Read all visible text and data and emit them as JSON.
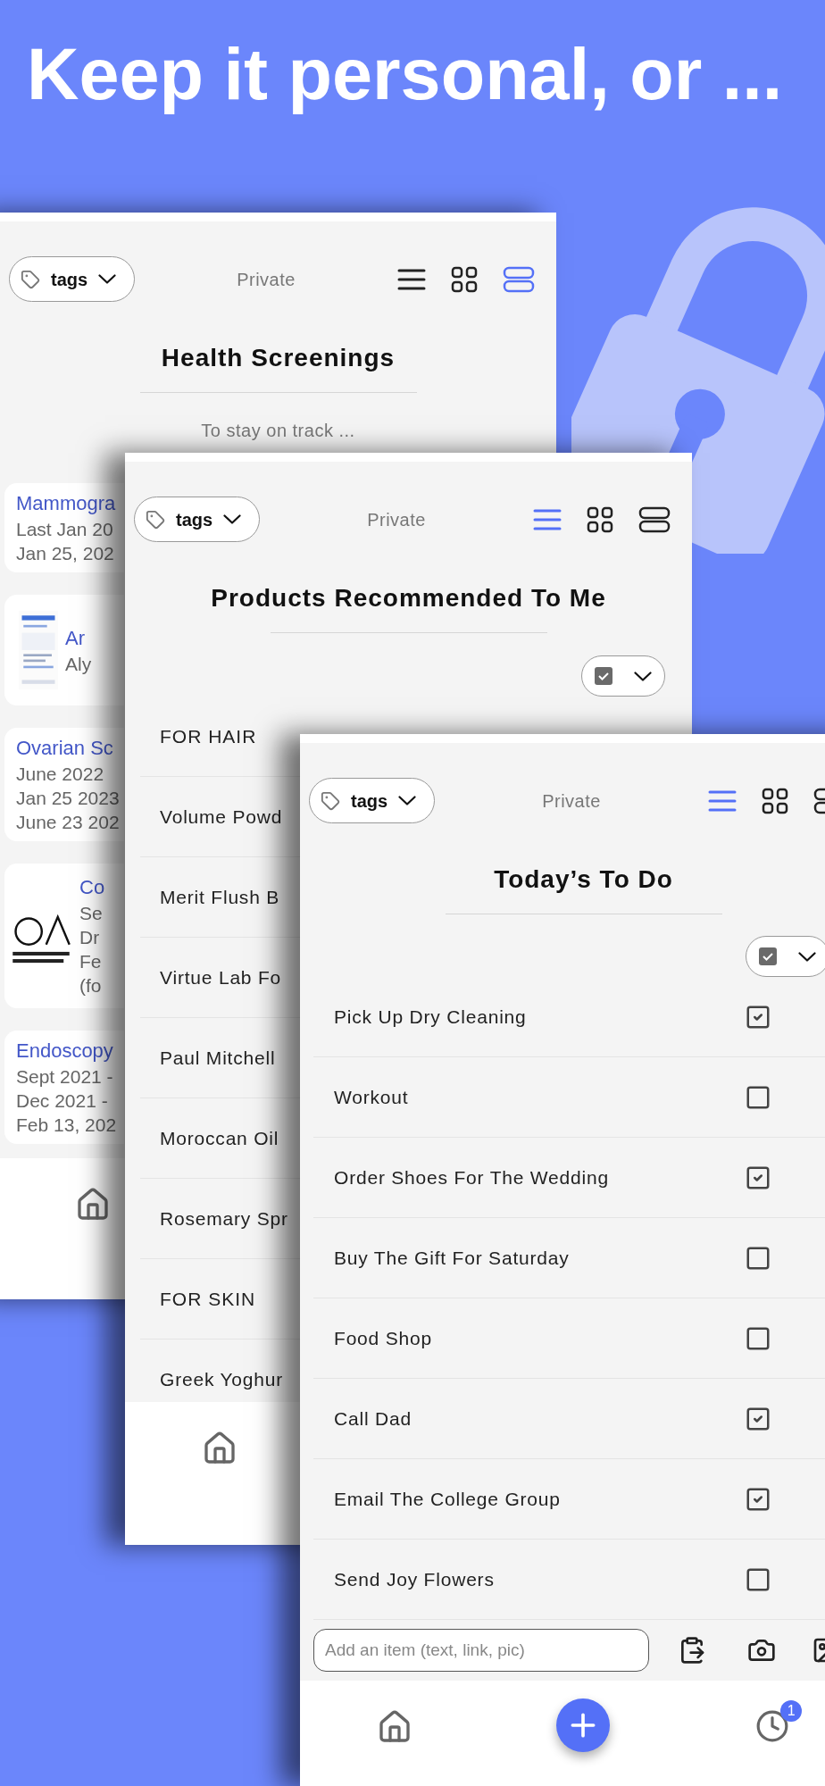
{
  "headline": "Keep it personal, or ...",
  "lists": [
    {
      "kind": "cards",
      "tags_label": "tags",
      "privacy": "Private",
      "view_modes": [
        {
          "kind": "list",
          "selected": false
        },
        {
          "kind": "grid",
          "selected": false
        },
        {
          "kind": "stack",
          "selected": true
        }
      ],
      "title": "Health Screenings",
      "subtitle": "To stay on track ...",
      "entries": [
        {
          "kind": "text",
          "title": "Mammogra",
          "lines": [
            "Last Jan 20",
            "Jan 25, 202"
          ]
        },
        {
          "kind": "thumbnail",
          "title": "Ar",
          "lines": [
            "Aly"
          ]
        },
        {
          "kind": "text",
          "title": "Ovarian Sc",
          "lines": [
            "June 2022",
            "Jan 25 2023",
            "June 23 202"
          ]
        },
        {
          "kind": "thumbnail",
          "title": "Co",
          "lines": [
            "Se",
            "Dr",
            "Fe",
            "(fo"
          ]
        },
        {
          "kind": "text",
          "title": "Endoscopy",
          "lines": [
            "Sept 2021 -",
            "Dec 2021 -",
            "Feb 13, 202"
          ]
        }
      ]
    },
    {
      "kind": "sections",
      "tags_label": "tags",
      "privacy": "Private",
      "view_modes": [
        {
          "kind": "list",
          "selected": true
        },
        {
          "kind": "grid",
          "selected": false
        },
        {
          "kind": "stack",
          "selected": false
        }
      ],
      "title": "Products Recommended To Me",
      "rows": [
        {
          "kind": "heading",
          "text": "FOR HAIR"
        },
        {
          "kind": "item",
          "text": "Volume Powd"
        },
        {
          "kind": "item",
          "text": "Merit Flush B"
        },
        {
          "kind": "item",
          "text": "Virtue Lab Fo"
        },
        {
          "kind": "item",
          "text": "Paul Mitchell"
        },
        {
          "kind": "item",
          "text": "Moroccan Oil"
        },
        {
          "kind": "item",
          "text": "Rosemary Spr"
        },
        {
          "kind": "heading",
          "text": "FOR SKIN"
        },
        {
          "kind": "item",
          "text": "Greek Yoghur"
        }
      ]
    },
    {
      "kind": "todo",
      "tags_label": "tags",
      "privacy": "Private",
      "view_modes": [
        {
          "kind": "list",
          "selected": true
        },
        {
          "kind": "grid",
          "selected": false
        },
        {
          "kind": "stack",
          "selected": false
        }
      ],
      "title": "Today’s To Do",
      "rows": [
        {
          "text": "Pick Up Dry Cleaning",
          "checked": true
        },
        {
          "text": "Workout",
          "checked": false
        },
        {
          "text": "Order Shoes For The Wedding",
          "checked": true
        },
        {
          "text": "Buy The Gift For Saturday",
          "checked": false
        },
        {
          "text": "Food Shop",
          "checked": false
        },
        {
          "text": "Call Dad",
          "checked": true
        },
        {
          "text": "Email The College Group",
          "checked": true
        },
        {
          "text": "Send Joy Flowers",
          "checked": false
        }
      ],
      "add_field": {
        "placeholder": "Add an item (text, link, pic)"
      },
      "reminder_badge": "1"
    }
  ]
}
